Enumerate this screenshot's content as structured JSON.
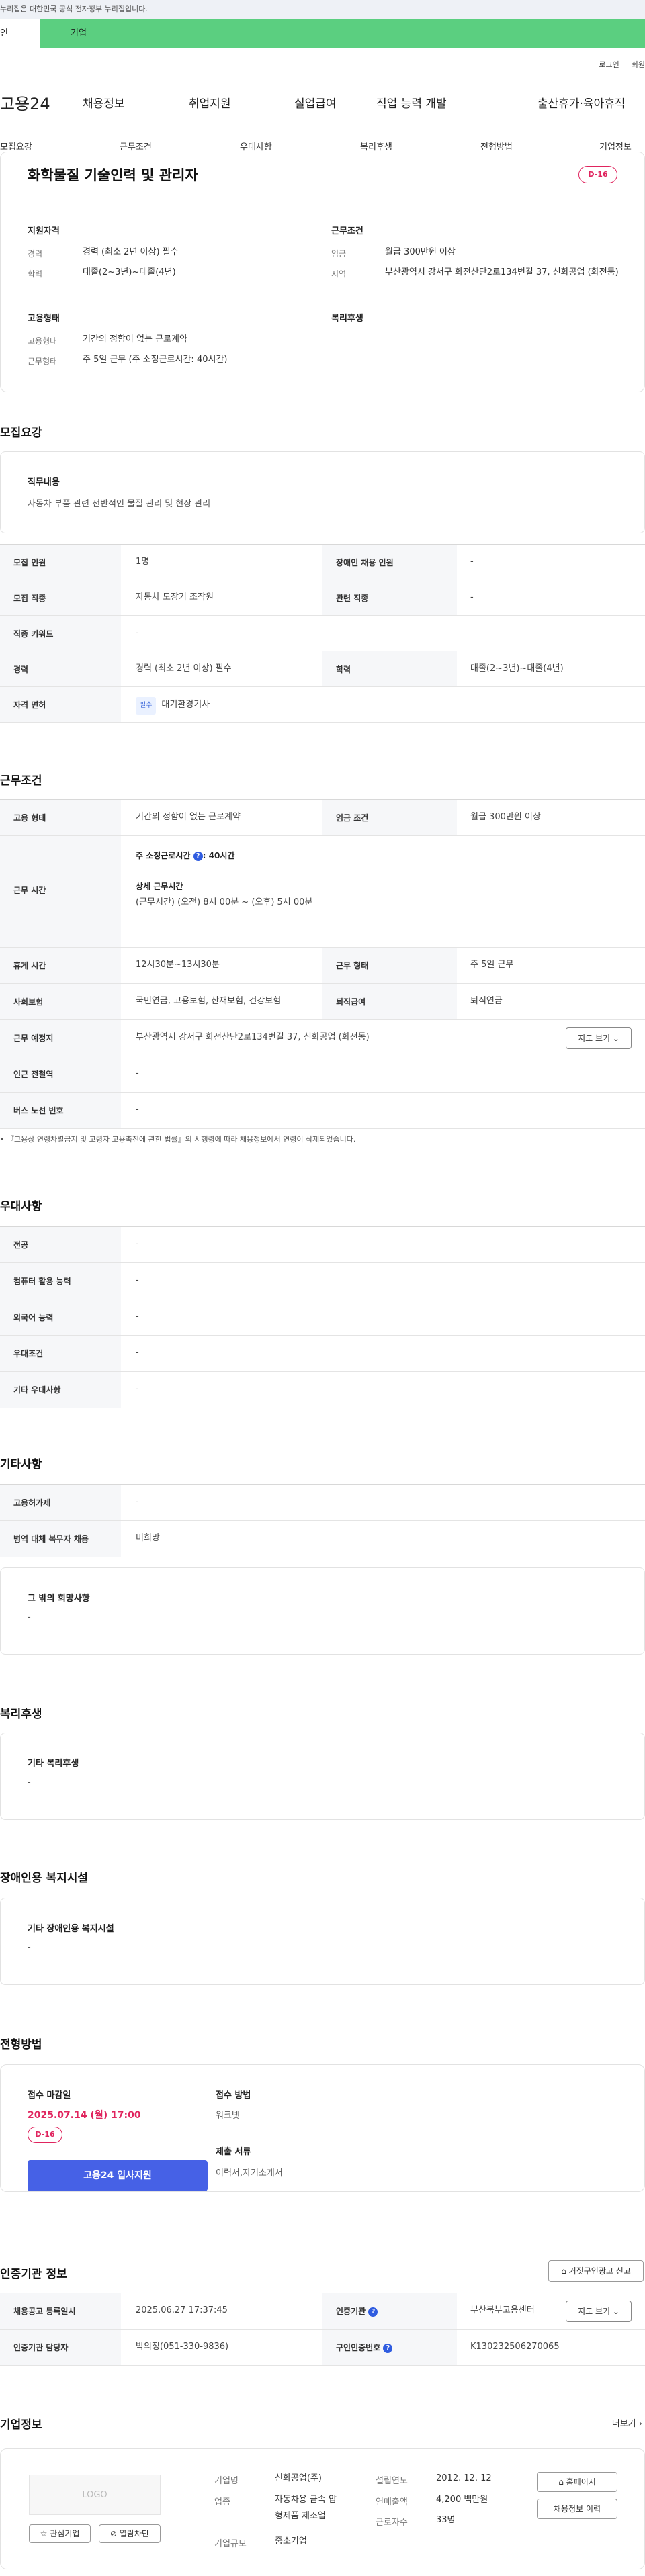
{
  "banner": {
    "text": "누리집은 대한민국 공식 전자정부 누리집입니다."
  },
  "tabs": {
    "person": "인",
    "company": "기업"
  },
  "util": {
    "login": "로그인",
    "join": "회원"
  },
  "gnb": {
    "logo": "고용24",
    "menu": [
      "채용정보",
      "취업지원",
      "실업급여",
      "직업 능력 개발",
      "출산휴가·육아휴직"
    ]
  },
  "subnav": [
    "모집요강",
    "근무조건",
    "우대사항",
    "복리후생",
    "전형방법",
    "기업정보"
  ],
  "summary": {
    "title": "화학물질 기술인력 및 관리자",
    "dday": "D-16",
    "qual_h": "지원자격",
    "career_l": "경력",
    "career_v": "경력 (최소 2년 이상) 필수",
    "edu_l": "학력",
    "edu_v": "대졸(2~3년)~대졸(4년)",
    "emp_h": "고용형태",
    "emptype_l": "고용형태",
    "emptype_v": "기간의 정함이 없는 근로계약",
    "worktype_l": "근무형태",
    "worktype_v": "주 5일 근무 (주 소정근로시간: 40시간)",
    "cond_h": "근무조건",
    "wage_l": "임금",
    "wage_v": "월급 300만원 이상",
    "region_l": "지역",
    "region_v": "부산광역시 강서구 화전산단2로134번길 37, 신화공업 (화전동)",
    "welfare_h": "복리후생"
  },
  "recruit": {
    "title": "모집요강",
    "duty_h": "직무내용",
    "duty_v": "자동차 부품 관련 전반적인 물질 관리 및 현장 관리",
    "rows": [
      {
        "l": "모집 인원",
        "v": "1명",
        "l2": "장애인 채용 인원",
        "v2": "-"
      },
      {
        "l": "모집 직종",
        "v": "자동차 도장기 조작원",
        "l2": "관련 직종",
        "v2": "-"
      },
      {
        "l": "직종 키워드",
        "v": "-"
      },
      {
        "l": "경력",
        "v": "경력 (최소 2년 이상) 필수",
        "l2": "학력",
        "v2": "대졸(2~3년)~대졸(4년)"
      }
    ],
    "license_l": "자격 면허",
    "license_tag": "필수",
    "license_v": "대기환경기사"
  },
  "work": {
    "title": "근무조건",
    "emptype_l": "고용 형태",
    "emptype_v": "기간의 정함이 없는 근로계약",
    "wagecond_l": "임금 조건",
    "wagecond_v": "월급 300만원 이상",
    "hours_l": "근무 시간",
    "hours_week": "주 소정근로시간",
    "hours_week_v": ": 40시간",
    "hours_detail_h": "상세 근무시간",
    "hours_detail_v": "(근무시간) (오전) 8시 00분 ~ (오후) 5시 00분",
    "break_l": "휴게 시간",
    "break_v": "12시30분~13시30분",
    "form_l": "근무 형태",
    "form_v": "주 5일 근무",
    "ins_l": "사회보험",
    "ins_v": "국민연금, 고용보험, 산재보험, 건강보험",
    "retire_l": "퇴직급여",
    "retire_v": "퇴직연금",
    "place_l": "근무 예정지",
    "place_v": "부산광역시 강서구 화전산단2로134번길 37, 신화공업 (화전동)",
    "map_btn": "지도 보기",
    "subway_l": "인근 전철역",
    "subway_v": "-",
    "bus_l": "버스 노선 번호",
    "bus_v": "-",
    "note": "• 『고용상 연령차별금지 및 고령자 고용촉진에 관한 법률』의 시행령에 따라 채용정보에서 연령이 삭제되었습니다."
  },
  "pref": {
    "title": "우대사항",
    "rows": [
      {
        "l": "전공",
        "v": "-"
      },
      {
        "l": "컴퓨터 활용 능력",
        "v": "-"
      },
      {
        "l": "외국어 능력",
        "v": "-"
      },
      {
        "l": "우대조건",
        "v": "-"
      },
      {
        "l": "기타 우대사항",
        "v": "-"
      }
    ]
  },
  "etc": {
    "title": "기타사항",
    "rows": [
      {
        "l": "고용허가제",
        "v": "-"
      },
      {
        "l": "병역 대체 복무자 채용",
        "v": "비희망"
      }
    ],
    "hope_h": "그 밖의 희망사항",
    "hope_v": "-"
  },
  "welfare": {
    "title": "복리후생",
    "h": "기타 복리후생",
    "v": "-"
  },
  "disabled": {
    "title": "장애인용 복지시설",
    "h": "기타 장애인용 복지시설",
    "v": "-"
  },
  "selection": {
    "title": "전형방법",
    "deadline_h": "접수 마감일",
    "deadline_v": "2025.07.14 (월) 17:00",
    "dday": "D-16",
    "apply_btn": "고용24 입사지원",
    "method_h": "접수 방법",
    "method_v": "워크넷",
    "docs_h": "제출 서류",
    "docs_v": "이력서,자기소개서"
  },
  "cert": {
    "title": "인증기관 정보",
    "report_btn": "거짓구인광고 신고",
    "reg_l": "채용공고 등록일시",
    "reg_v": "2025.06.27 17:37:45",
    "agency_l": "인증기관",
    "agency_v": "부산북부고용센터",
    "map_btn": "지도 보기",
    "mgr_l": "인증기관 담당자",
    "mgr_v": "박의정(051-330-9836)",
    "no_l": "구인인증번호",
    "no_v": "K130232506270065"
  },
  "company": {
    "title": "기업정보",
    "more": "더보기",
    "logo": "LOGO",
    "fav_btn": "관심기업",
    "block_btn": "열람차단",
    "name_l": "기업명",
    "name_v": "신화공업(주)",
    "biz_l": "업종",
    "biz_v1": "자동차용 금속 압",
    "biz_v2": "형제품 제조업",
    "size_l": "기업규모",
    "size_v": "중소기업",
    "est_l": "설립연도",
    "est_v": "2012. 12. 12",
    "sales_l": "연매출액",
    "sales_v": "4,200 백만원",
    "emp_l": "근로자수",
    "emp_v": "33명",
    "home_btn": "홈페이지",
    "jobs_btn": "채용정보 이력"
  }
}
